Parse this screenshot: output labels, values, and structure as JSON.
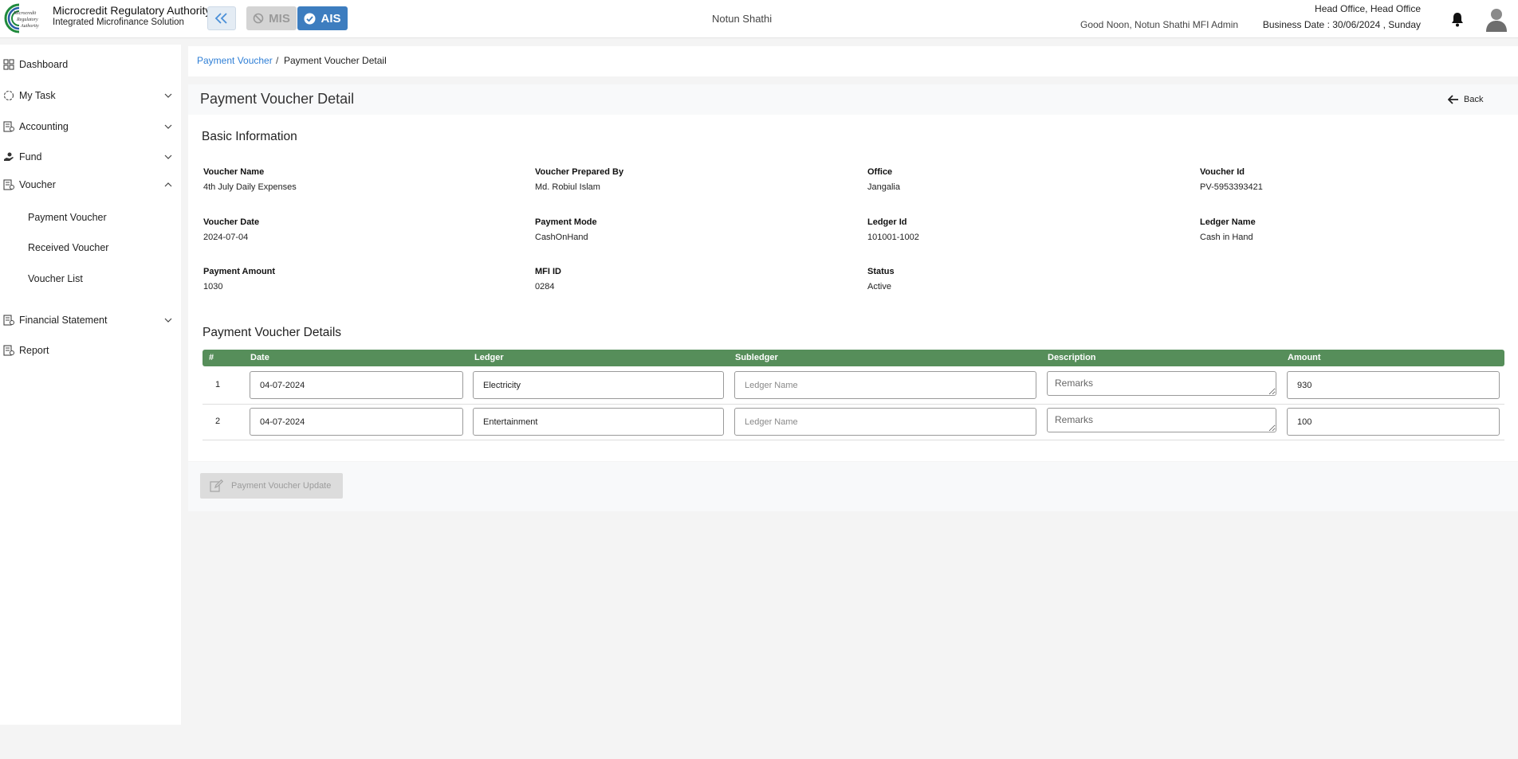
{
  "header": {
    "brand_title": "Microcredit Regulatory Authority",
    "brand_subtitle": "Integrated Microfinance Solution",
    "modules": {
      "mis": "MIS",
      "ais": "AIS"
    },
    "organization": "Notun Shathi",
    "greeting": "Good Noon, Notun Shathi MFI Admin",
    "office": "Head Office, Head Office",
    "business_date": "Business Date : 30/06/2024 , Sunday"
  },
  "sidebar": {
    "items": [
      {
        "label": "Dashboard",
        "icon": "grid-icon"
      },
      {
        "label": "My Task",
        "icon": "task-icon"
      },
      {
        "label": "Accounting",
        "icon": "accounting-icon"
      },
      {
        "label": "Fund",
        "icon": "hand-money-icon"
      },
      {
        "label": "Voucher",
        "icon": "voucher-icon"
      },
      {
        "label": "Financial Statement",
        "icon": "statement-icon"
      },
      {
        "label": "Report",
        "icon": "report-icon"
      }
    ],
    "voucher_submenu": [
      "Payment Voucher",
      "Received Voucher",
      "Voucher List"
    ]
  },
  "breadcrumb": {
    "parent": "Payment Voucher",
    "separator": "/",
    "current": "Payment Voucher Detail"
  },
  "page": {
    "title": "Payment Voucher Detail",
    "back_label": "Back"
  },
  "basic_info": {
    "title": "Basic Information",
    "fields": [
      {
        "label": "Voucher Name",
        "value": "4th July Daily Expenses"
      },
      {
        "label": "Voucher Prepared By",
        "value": "Md. Robiul Islam"
      },
      {
        "label": "Office",
        "value": "Jangalia"
      },
      {
        "label": "Voucher Id",
        "value": "PV-5953393421"
      },
      {
        "label": "Voucher Date",
        "value": "2024-07-04"
      },
      {
        "label": "Payment Mode",
        "value": "CashOnHand"
      },
      {
        "label": "Ledger Id",
        "value": "101001-1002"
      },
      {
        "label": "Ledger Name",
        "value": "Cash in Hand"
      },
      {
        "label": "Payment Amount",
        "value": "1030"
      },
      {
        "label": "MFI ID",
        "value": "0284"
      },
      {
        "label": "Status",
        "value": "Active"
      }
    ]
  },
  "details": {
    "title": "Payment Voucher Details",
    "columns": [
      "#",
      "Date",
      "Ledger",
      "Subledger",
      "Description",
      "Amount"
    ],
    "subledger_placeholder": "Ledger Name",
    "description_placeholder": "Remarks",
    "rows": [
      {
        "num": "1",
        "date": "04-07-2024",
        "ledger": "Electricity",
        "subledger": "",
        "description": "",
        "amount": "930"
      },
      {
        "num": "2",
        "date": "04-07-2024",
        "ledger": "Entertainment",
        "subledger": "",
        "description": "",
        "amount": "100"
      }
    ]
  },
  "actions": {
    "update_label": "Payment Voucher Update"
  },
  "colors": {
    "accent_blue": "#3d7dbf",
    "table_header_green": "#568e5a",
    "link_blue": "#2f7fd6"
  }
}
